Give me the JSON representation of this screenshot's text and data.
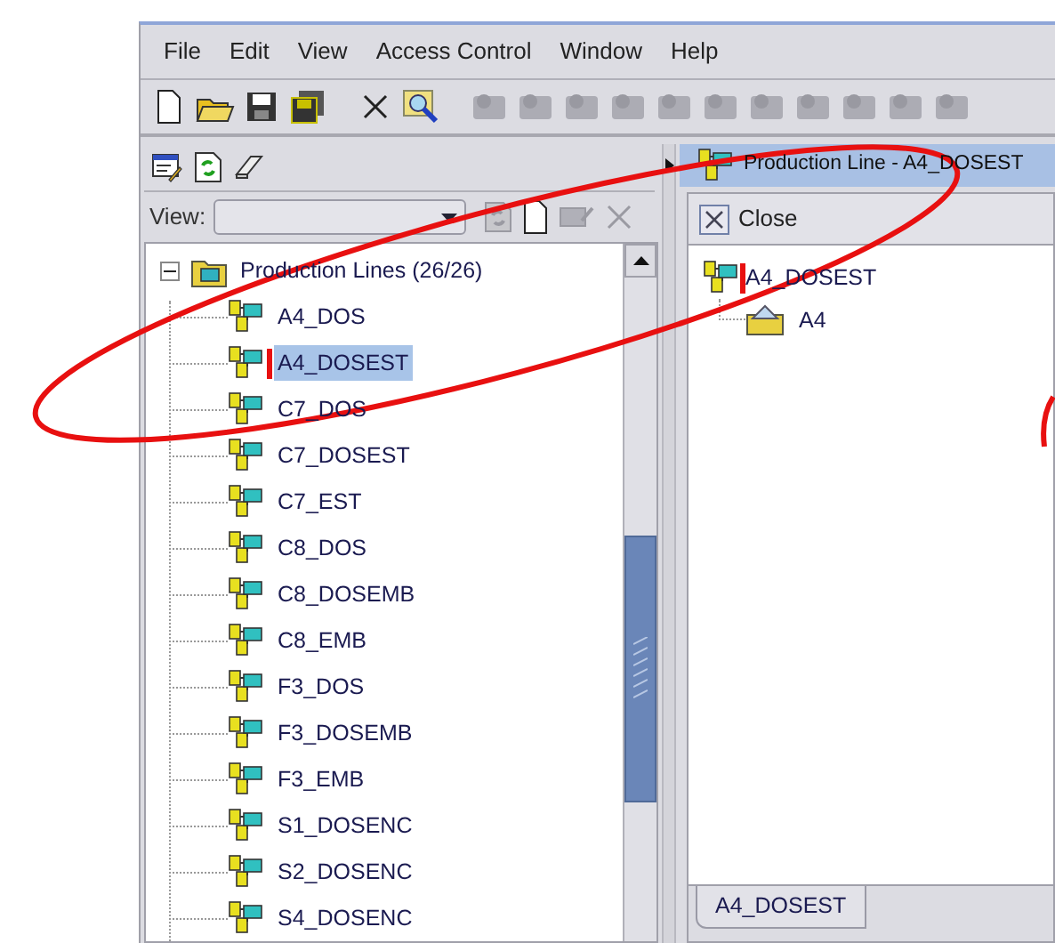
{
  "menu": [
    "File",
    "Edit",
    "View",
    "Access Control",
    "Window",
    "Help"
  ],
  "toolbar": [
    {
      "kind": "new",
      "disabled": false
    },
    {
      "kind": "open",
      "disabled": false
    },
    {
      "kind": "save",
      "disabled": false
    },
    {
      "kind": "save-all",
      "disabled": false
    },
    {
      "kind": "delete",
      "disabled": false
    },
    {
      "kind": "find",
      "disabled": false
    },
    {
      "kind": "tool",
      "disabled": true
    },
    {
      "kind": "tool",
      "disabled": true
    },
    {
      "kind": "tool",
      "disabled": true
    },
    {
      "kind": "tool",
      "disabled": true
    },
    {
      "kind": "tool",
      "disabled": true
    },
    {
      "kind": "tool",
      "disabled": true
    },
    {
      "kind": "tool",
      "disabled": true
    },
    {
      "kind": "tool",
      "disabled": true
    },
    {
      "kind": "tool",
      "disabled": true
    },
    {
      "kind": "tool",
      "disabled": true
    },
    {
      "kind": "tool",
      "disabled": true
    }
  ],
  "left_panel": {
    "view_label": "View:",
    "view_actions": [
      {
        "kind": "refresh",
        "disabled": true
      },
      {
        "kind": "new",
        "disabled": false
      },
      {
        "kind": "edit",
        "disabled": true
      },
      {
        "kind": "delete",
        "disabled": true
      }
    ],
    "tree": {
      "label": "Production Lines (26/26)",
      "expanded": true,
      "children": [
        {
          "label": "A4_DOS",
          "selected": false
        },
        {
          "label": "A4_DOSEST",
          "selected": true
        },
        {
          "label": "C7_DOS",
          "selected": false
        },
        {
          "label": "C7_DOSEST",
          "selected": false
        },
        {
          "label": "C7_EST",
          "selected": false
        },
        {
          "label": "C8_DOS",
          "selected": false
        },
        {
          "label": "C8_DOSEMB",
          "selected": false
        },
        {
          "label": "C8_EMB",
          "selected": false
        },
        {
          "label": "F3_DOS",
          "selected": false
        },
        {
          "label": "F3_DOSEMB",
          "selected": false
        },
        {
          "label": "F3_EMB",
          "selected": false
        },
        {
          "label": "S1_DOSENC",
          "selected": false
        },
        {
          "label": "S2_DOSENC",
          "selected": false
        },
        {
          "label": "S4_DOSENC",
          "selected": false
        }
      ]
    }
  },
  "right_panel": {
    "title": "Production Line - A4_DOSEST",
    "close_label": "Close",
    "tree": {
      "label": "A4_DOSEST",
      "children": [
        {
          "label": "A4"
        }
      ]
    },
    "tabs": [
      {
        "label": "A4_DOSEST",
        "selected": true
      }
    ]
  }
}
